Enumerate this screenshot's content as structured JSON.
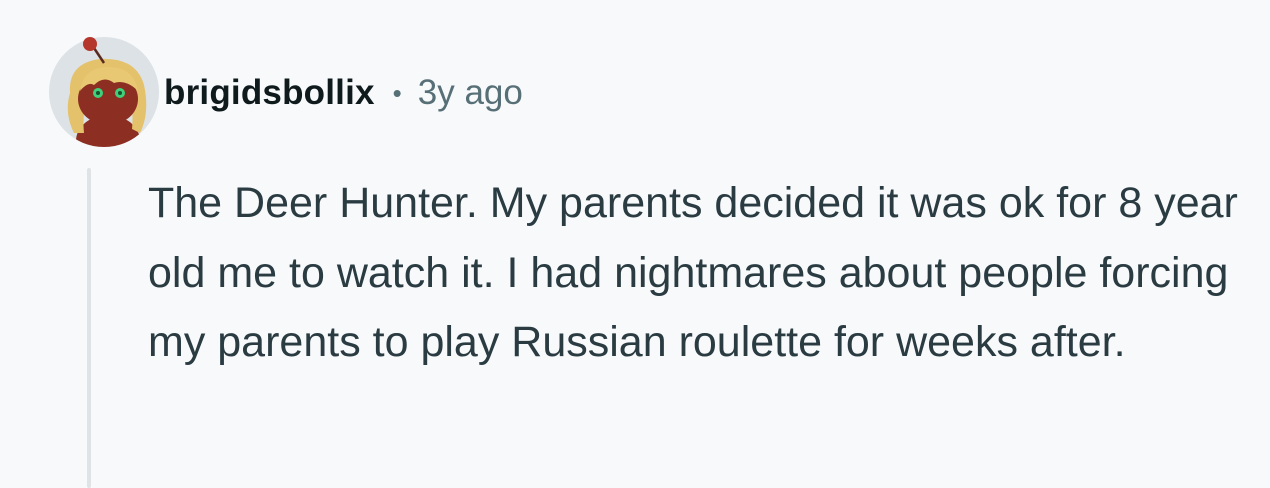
{
  "comment": {
    "author": "brigidsbollix",
    "separator": "•",
    "timestamp": "3y ago",
    "body": "The Deer Hunter. My parents decided it was ok for 8 year old me to watch it. I had nightmares about people forcing my parents to play Russian roulette for weeks after."
  },
  "colors": {
    "background": "#f8f9fb",
    "username": "#0f1a1c",
    "meta": "#576f76",
    "body_text": "#2a3c42",
    "thread_line": "#dfe3e6"
  }
}
